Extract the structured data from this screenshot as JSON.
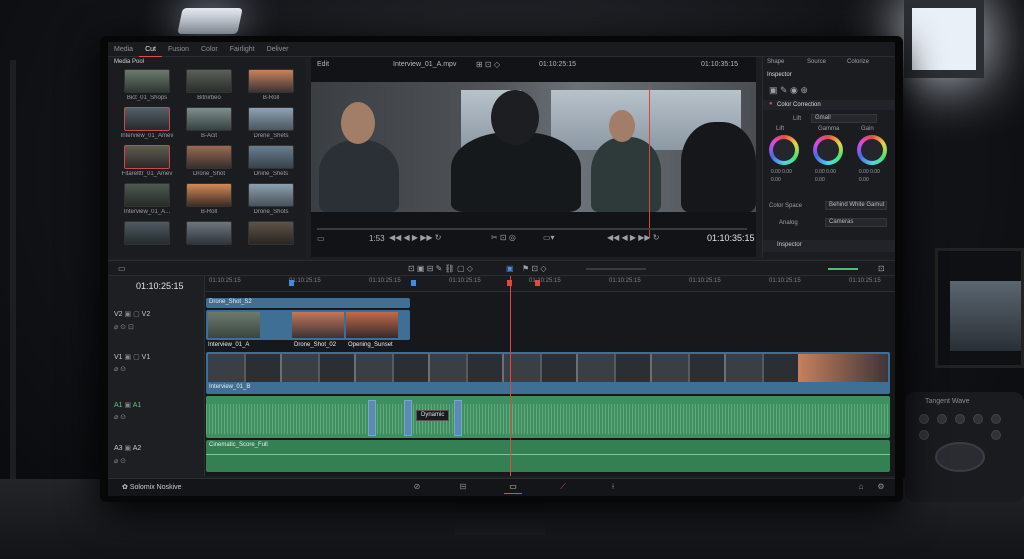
{
  "page_tabs": [
    "Media",
    "Cut",
    "Fusion",
    "Color",
    "Fairlight",
    "Deliver"
  ],
  "active_page_tab": 1,
  "media_pool": {
    "title": "Media Pool",
    "clips": [
      {
        "name": "Bict_01_Shops"
      },
      {
        "name": "Bitnirbeo"
      },
      {
        "name": "B-Roll"
      },
      {
        "name": "Interview_01_Amev"
      },
      {
        "name": "B-Acit"
      },
      {
        "name": "Drene_Shets"
      },
      {
        "name": "Fitarelttr_01_Amev"
      },
      {
        "name": "Drone_Shot"
      },
      {
        "name": "Dnine_Shets"
      },
      {
        "name": "Interview_01_A..."
      },
      {
        "name": "B-Roll"
      },
      {
        "name": "Drone_Shots"
      },
      {
        "name": "",
        "thumb": "t13"
      },
      {
        "name": "",
        "thumb": "t14"
      },
      {
        "name": "",
        "thumb": "t15"
      }
    ]
  },
  "viewer": {
    "left_label": "Edit",
    "clip_name": "Interview_01_A.mpv",
    "source_tc": "01:10:25:15",
    "record_tc": "01:10:35:15",
    "bottom_tc": "01:10:35:15",
    "zoom_text": "1:53"
  },
  "inspector": {
    "header_tabs": [
      "Shape",
      "Source",
      "Colorize"
    ],
    "title": "Inspector",
    "section": "Color Correction",
    "lift_label": "Lift",
    "lift_value": "Gmall",
    "wheels": [
      {
        "name": "Lift",
        "values": [
          "0.00",
          "0.00",
          "0.00"
        ]
      },
      {
        "name": "Gamma",
        "values": [
          "0.00",
          "0.00",
          "0.00"
        ]
      },
      {
        "name": "Gain",
        "values": [
          "0.00",
          "0.00",
          "0.00"
        ]
      }
    ],
    "color_space_label": "Color Space",
    "color_space_value": "Behind White Gamut",
    "analog_label": "Analog",
    "analog_value": "Cameras",
    "footer": "Inspector"
  },
  "timeline": {
    "current_tc": "01:10:25:15",
    "ruler": [
      "01:10:25:15",
      "01:10:25:15",
      "01:10:25:15",
      "01:10:25:15",
      "01:10:25:15",
      "01:10:25:15",
      "01:10:25:15",
      "01:10:25:15",
      "01:10:25:15"
    ],
    "tracks": [
      {
        "id": "V2",
        "name": "V2"
      },
      {
        "id": "V1",
        "name": "V1"
      },
      {
        "id": "A1",
        "name": "A1"
      },
      {
        "id": "A3",
        "name": "A2"
      }
    ],
    "v2_title": "Drone_Shot_S2",
    "v2_clips": [
      "Interview_01_A",
      "Drone_Shot_02",
      "Opening_Sunset"
    ],
    "v1_clip": "Interview_01_B",
    "tooltip": "Dynamic",
    "a2_clip": "Cinematic_Score_Full"
  },
  "bottom": {
    "brand": "Solomix Noskive"
  },
  "desk_panel": {
    "label": "Tangent Wave"
  }
}
